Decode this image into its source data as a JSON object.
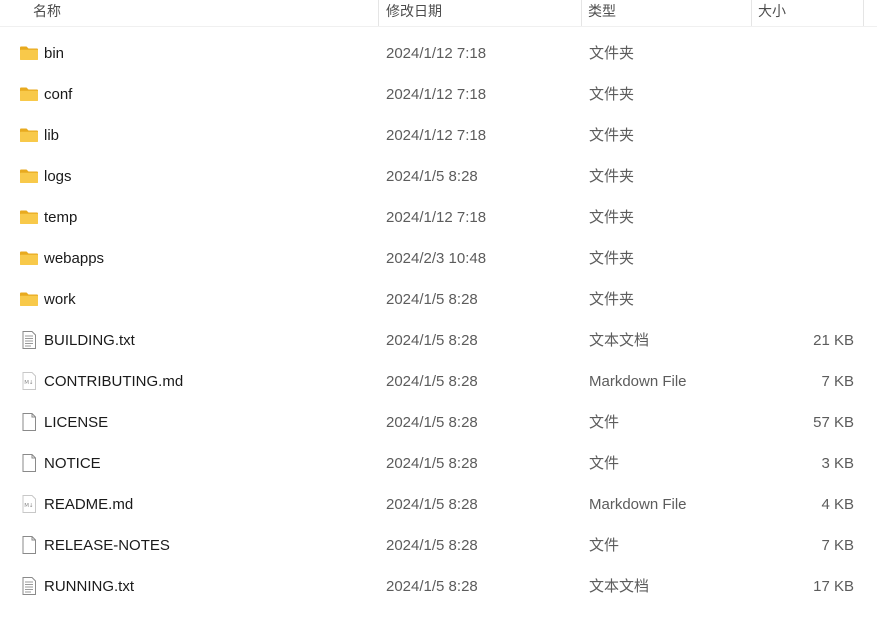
{
  "columns": {
    "name": "名称",
    "date": "修改日期",
    "type": "类型",
    "size": "大小"
  },
  "colors": {
    "folder": "#f8c94a",
    "folder_dark": "#e8aa1f",
    "doc_stroke": "#8a8a8a"
  },
  "files": [
    {
      "name": "bin",
      "date": "2024/1/12 7:18",
      "type": "文件夹",
      "size": "",
      "icon": "folder-icon"
    },
    {
      "name": "conf",
      "date": "2024/1/12 7:18",
      "type": "文件夹",
      "size": "",
      "icon": "folder-icon"
    },
    {
      "name": "lib",
      "date": "2024/1/12 7:18",
      "type": "文件夹",
      "size": "",
      "icon": "folder-icon"
    },
    {
      "name": "logs",
      "date": "2024/1/5 8:28",
      "type": "文件夹",
      "size": "",
      "icon": "folder-icon"
    },
    {
      "name": "temp",
      "date": "2024/1/12 7:18",
      "type": "文件夹",
      "size": "",
      "icon": "folder-icon"
    },
    {
      "name": "webapps",
      "date": "2024/2/3 10:48",
      "type": "文件夹",
      "size": "",
      "icon": "folder-icon"
    },
    {
      "name": "work",
      "date": "2024/1/5 8:28",
      "type": "文件夹",
      "size": "",
      "icon": "folder-icon"
    },
    {
      "name": "BUILDING.txt",
      "date": "2024/1/5 8:28",
      "type": "文本文档",
      "size": "21 KB",
      "icon": "text-file-icon"
    },
    {
      "name": "CONTRIBUTING.md",
      "date": "2024/1/5 8:28",
      "type": "Markdown File",
      "size": "7 KB",
      "icon": "markdown-file-icon"
    },
    {
      "name": "LICENSE",
      "date": "2024/1/5 8:28",
      "type": "文件",
      "size": "57 KB",
      "icon": "blank-file-icon"
    },
    {
      "name": "NOTICE",
      "date": "2024/1/5 8:28",
      "type": "文件",
      "size": "3 KB",
      "icon": "blank-file-icon"
    },
    {
      "name": "README.md",
      "date": "2024/1/5 8:28",
      "type": "Markdown File",
      "size": "4 KB",
      "icon": "markdown-file-icon"
    },
    {
      "name": "RELEASE-NOTES",
      "date": "2024/1/5 8:28",
      "type": "文件",
      "size": "7 KB",
      "icon": "blank-file-icon"
    },
    {
      "name": "RUNNING.txt",
      "date": "2024/1/5 8:28",
      "type": "文本文档",
      "size": "17 KB",
      "icon": "text-file-icon"
    }
  ]
}
